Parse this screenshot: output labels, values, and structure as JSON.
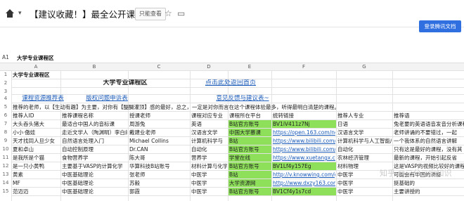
{
  "topbar": {
    "title": "【建议收藏！】最全公开课知识库",
    "readonly_label": "只能查看",
    "login_label": "登录腾讯文档"
  },
  "formula_bar": {
    "cell_ref": "A1",
    "value": "大学专业课程区"
  },
  "columns": [
    "A",
    "B",
    "C",
    "D",
    "E",
    "F",
    "G"
  ],
  "rows": [
    {
      "n": "1",
      "cells": {
        "A": "大学专业课程区"
      }
    },
    {
      "n": "2",
      "cells": {
        "B": "大学专业课程区",
        "D": "点击此处返回首页"
      }
    },
    {
      "n": "3",
      "cells": {}
    },
    {
      "n": "4",
      "cells": {
        "A": "课程资源推荐表",
        "B": "版权问题申诉表",
        "D": "意见反馈与建议表~"
      }
    },
    {
      "n": "5",
      "cells": {
        "A": "推荐的老师，以【生动有趣】为主要，对你有【醍醐灌顶】感的最好，总之，一定是对你而言在这个课程体验最多，听得最明白清楚的课程。"
      }
    },
    {
      "n": "6",
      "cells": {
        "A": "推荐人ID",
        "B": "推荐课程名称",
        "C": "授课老师",
        "D": "课程对应专业",
        "E": "课程所在平台",
        "F": "统转链接",
        "G": "推荐人专业",
        "H": "推荐语"
      }
    },
    {
      "n": "7",
      "cells": {
        "A": "大头吞头猪大",
        "B": "最适合中国人的音标课",
        "C": "周游兔",
        "D": "英语",
        "E": "B站官方账号",
        "F": "BV1iV411z7Nj",
        "G": "日语",
        "H": "兔老要的英语语音发音分析课程"
      }
    },
    {
      "n": "8",
      "cells": {
        "A": "小小·傲娃",
        "B": "走近文学人（陶渊明）李白的诗",
        "C": "戴建业老师",
        "D": "汉语言文学",
        "E": "中国大学慕课",
        "F": "https://open.163.com/new",
        "G": "汉语言文学",
        "H": "老师讲诵的不要错过，一起"
      }
    },
    {
      "n": "9",
      "cells": {
        "A": "天才找同人旦少女",
        "B": "自然语言处理入门",
        "C": "Michael Collins",
        "D": "计算机科学与",
        "E": "B站",
        "F": "https://www.bilibili.com/video",
        "G": "计算机科学与人工智能/计算",
        "H": "一个我体系的自然语言讲解"
      }
    },
    {
      "n": "10",
      "cells": {
        "A": "夏和卓山",
        "B": "自动控制原理",
        "C": "Dr.CAN",
        "D": "自动化",
        "E": "B站官方账号",
        "F": "https://www.bilibili.com/vi",
        "G": "自动化",
        "H": "只有这是最好的课程，没有其"
      }
    },
    {
      "n": "11",
      "cells": {
        "A": "是我所是个猫",
        "B": "食物营养学",
        "C": "陈大哥",
        "D": "营养学",
        "E": "学堂在线",
        "F": "https://www.xuetangx.com/c",
        "G": "农林经济管理",
        "H": "最新的课程，开始引起反省"
      }
    },
    {
      "n": "12",
      "cells": {
        "A": "是一只小黄鸭",
        "B": "主要基于VASP的计算化学",
        "C": "华算科技B站账号",
        "D": "材料计算与化学",
        "E": "B站官方账号",
        "F": "BV1Lf4y157Eg",
        "G": "材料物理",
        "H": "这是VASP的视频比较好的课程"
      }
    },
    {
      "n": "13",
      "cells": {
        "A": "黄素",
        "B": "中医基础理论",
        "C": "张老师",
        "D": "中医学",
        "E": "B站",
        "F": "http://v.knowwing.com/gme",
        "G": "中医学",
        "H": "可能会有中国的讲解"
      }
    },
    {
      "n": "14",
      "cells": {
        "A": "MF",
        "B": "中医基础理论",
        "C": "苏毅",
        "D": "中医学",
        "E": "大学资源网",
        "F": "http://www.dxzy163.com/vie",
        "G": "中医学",
        "H": "挺基础的"
      }
    },
    {
      "n": "15",
      "cells": {
        "A": "范迈迈",
        "B": "中医基础理论",
        "C": "郭霞",
        "D": "中医学",
        "E": "B站官方账号",
        "F": "BV1Cf4y1s7cd",
        "G": "中医学",
        "H": "主要讲授的"
      }
    }
  ],
  "watermark": "知乎 @三分二宝知识"
}
